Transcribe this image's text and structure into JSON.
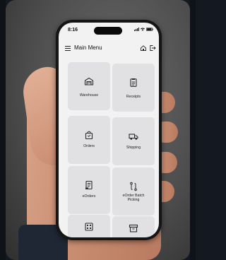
{
  "status_bar": {
    "time": "8:16"
  },
  "header": {
    "title": "Main Menu"
  },
  "menu": {
    "warehouse": "Warehouse",
    "receipts": "Receipts",
    "orders": "Orders",
    "shipping": "Shipping",
    "eorders": "eOrders",
    "eorder_batch_picking": "eOrder Batch Picking"
  },
  "icons": {
    "hamburger": "menu-icon",
    "home": "home-icon",
    "logout": "logout-icon",
    "warehouse": "warehouse-icon",
    "receipts": "receipt-icon",
    "orders": "shopping-bag-icon",
    "shipping": "truck-icon",
    "eorders": "document-icon",
    "batch": "route-icon"
  },
  "colors": {
    "screen_bg": "#f2f2f2",
    "tile_bg": "#e1e1e4",
    "icon": "#2b2b2b"
  }
}
